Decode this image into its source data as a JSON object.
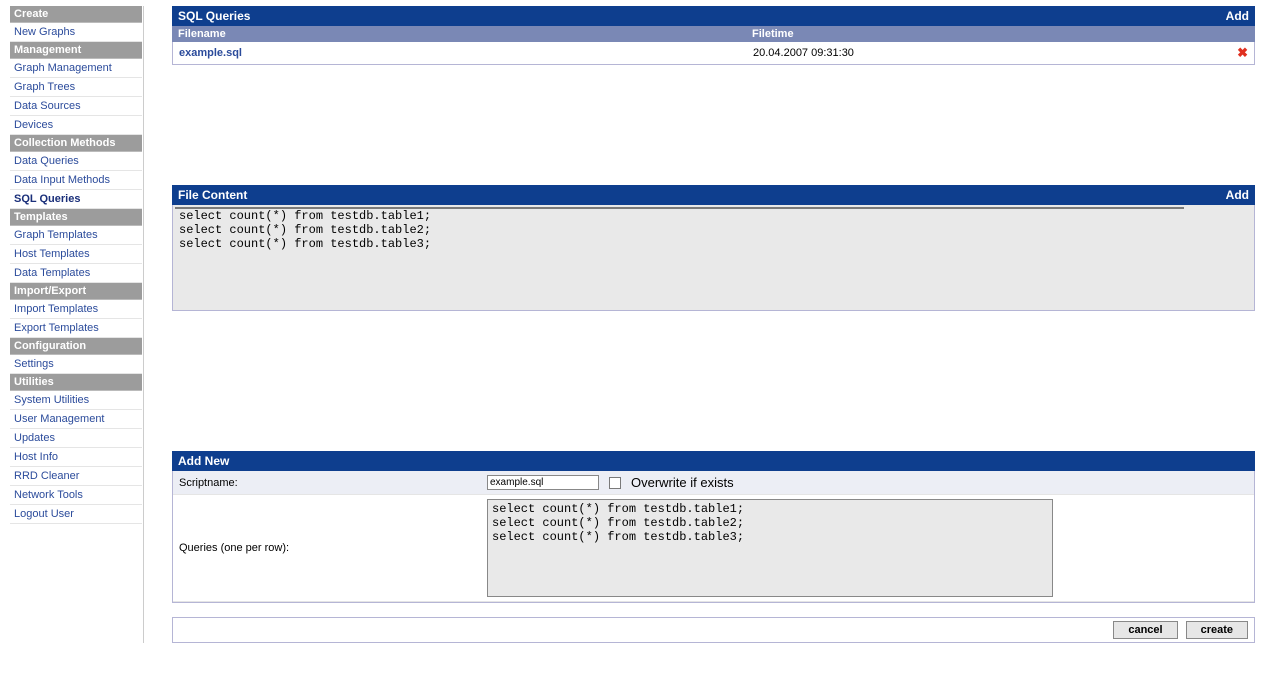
{
  "sidebar": {
    "sections": [
      {
        "header": "Create",
        "items": [
          "New Graphs"
        ]
      },
      {
        "header": "Management",
        "items": [
          "Graph Management",
          "Graph Trees",
          "Data Sources",
          "Devices"
        ]
      },
      {
        "header": "Collection Methods",
        "items": [
          "Data Queries",
          "Data Input Methods",
          "SQL Queries"
        ],
        "active_index": 2
      },
      {
        "header": "Templates",
        "items": [
          "Graph Templates",
          "Host Templates",
          "Data Templates"
        ]
      },
      {
        "header": "Import/Export",
        "items": [
          "Import Templates",
          "Export Templates"
        ]
      },
      {
        "header": "Configuration",
        "items": [
          "Settings"
        ]
      },
      {
        "header": "Utilities",
        "items": [
          "System Utilities",
          "User Management",
          "Updates",
          "Host Info",
          "RRD Cleaner",
          "Network Tools",
          "Logout User"
        ]
      }
    ]
  },
  "sql_queries_panel": {
    "title": "SQL Queries",
    "add_label": "Add",
    "columns": {
      "filename": "Filename",
      "filetime": "Filetime"
    },
    "rows": [
      {
        "filename": "example.sql",
        "filetime": "20.04.2007 09:31:30"
      }
    ]
  },
  "file_content_panel": {
    "title": "File Content",
    "add_label": "Add",
    "content": "select count(*) from testdb.table1;\nselect count(*) from testdb.table2;\nselect count(*) from testdb.table3;"
  },
  "add_new_panel": {
    "title": "Add New",
    "scriptname_label": "Scriptname:",
    "scriptname_value": "example.sql",
    "overwrite_label": "Overwrite if exists",
    "queries_label": "Queries (one per row):",
    "queries_value": "select count(*) from testdb.table1;\nselect count(*) from testdb.table2;\nselect count(*) from testdb.table3;"
  },
  "buttons": {
    "cancel": "cancel",
    "create": "create"
  }
}
